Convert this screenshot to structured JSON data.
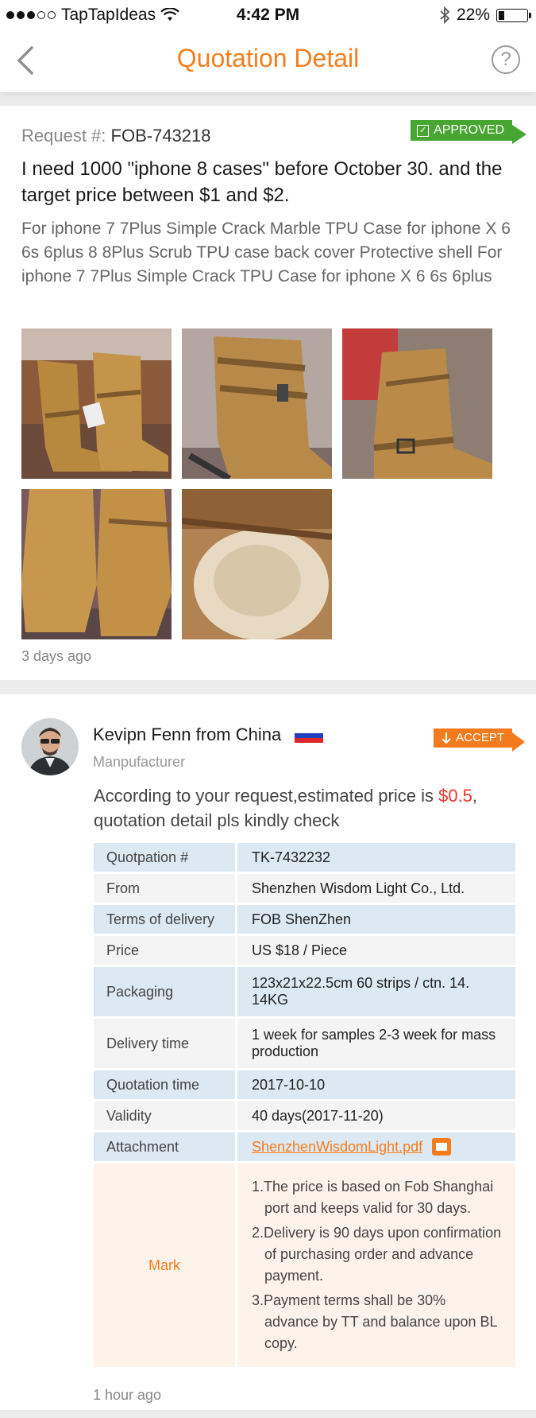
{
  "status_bar": {
    "carrier": "TapTapIdeas",
    "time": "4:42 PM",
    "battery": "22%",
    "battery_level": 0.22
  },
  "nav": {
    "title": "Quotation Detail"
  },
  "request": {
    "label": "Request #:",
    "number": "FOB-743218",
    "status_badge": "APPROVED",
    "title": "I need 1000 \"iphone 8 cases\" before October 30. and the target price between $1 and $2.",
    "description": "For iphone 7 7Plus Simple Crack Marble TPU Case for iphone X 6 6s 6plus 8 8Plus Scrub TPU case back cover Protective shell For iphone 7 7Plus Simple Crack TPU Case  for iphone X 6 6s 6plus",
    "images": [
      "boots-photo-1",
      "boots-photo-2",
      "boots-photo-3",
      "boots-photo-4",
      "boots-photo-5"
    ],
    "time_ago": "3 days ago"
  },
  "quote": {
    "supplier_name": "Kevipn Fenn from China",
    "role": "Manpufacturer",
    "accept_label": "ACCEPT",
    "estimate_prefix": "According to your request,estimated price is ",
    "estimate_price": "$0.5",
    "estimate_suffix": ", quotation detail pls kindly check",
    "rows": [
      {
        "label": "Quotpation #",
        "value": "TK-7432232"
      },
      {
        "label": "From",
        "value": "Shenzhen Wisdom Light Co., Ltd."
      },
      {
        "label": "Terms of delivery",
        "value": "FOB  ShenZhen"
      },
      {
        "label": "Price",
        "value": "US $18 / Piece"
      },
      {
        "label": "Packaging",
        "value": "123x21x22.5cm 60 strips / ctn. 14. 14KG"
      },
      {
        "label": "Delivery time",
        "value": "1 week for samples 2-3 week for mass production"
      },
      {
        "label": "Quotation time",
        "value": "2017-10-10"
      },
      {
        "label": "Validity",
        "value": "40 days(2017-11-20)"
      },
      {
        "label": "Attachment",
        "value": "ShenzhenWisdomLight.pdf"
      }
    ],
    "mark_label": "Mark",
    "marks": [
      "1.The price is based on Fob Shanghai port and keeps valid for 30 days.",
      "2.Delivery is 90 days upon confirmation of purchasing order and advance payment.",
      "3.Payment terms shall be 30% advance by TT and balance upon BL copy."
    ],
    "time_ago": "1 hour ago"
  },
  "colors": {
    "accent": "#f67d1b",
    "approved": "#47a631",
    "price": "#f1322c",
    "row_blue": "#dce9f3",
    "row_grey": "#f4f4f4",
    "mark_bg": "#fdf3ea"
  }
}
